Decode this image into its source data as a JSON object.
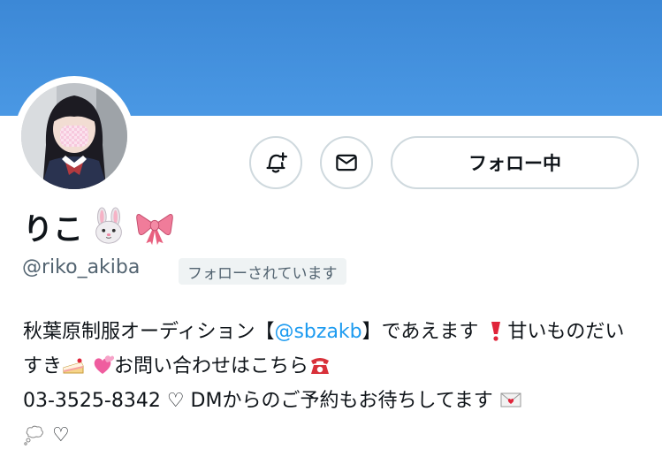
{
  "profile": {
    "display_name": "りこ",
    "name_emojis": [
      "rabbit-face",
      "ribbon"
    ],
    "handle": "@riko_akiba",
    "follows_you_badge": "フォローされています",
    "buttons": {
      "follow_label": "フォロー中"
    },
    "bio": {
      "line1_before": "秋葉原制服オーディション【",
      "mention": "@sbzakb",
      "line1_after": "】であえます",
      "line2_a": "甘いものだいすき",
      "line2_b": "お問い合わせはこちら",
      "line3": "03-3525-8342 ♡ DMからのご予約もお待ちしてます",
      "line4": "♡"
    }
  },
  "colors": {
    "banner": "#4a98e4",
    "link": "#1d9bf0",
    "handle_gray": "#536471",
    "button_border": "#cfd9de"
  },
  "icons": [
    "bell-plus-icon",
    "envelope-icon"
  ]
}
